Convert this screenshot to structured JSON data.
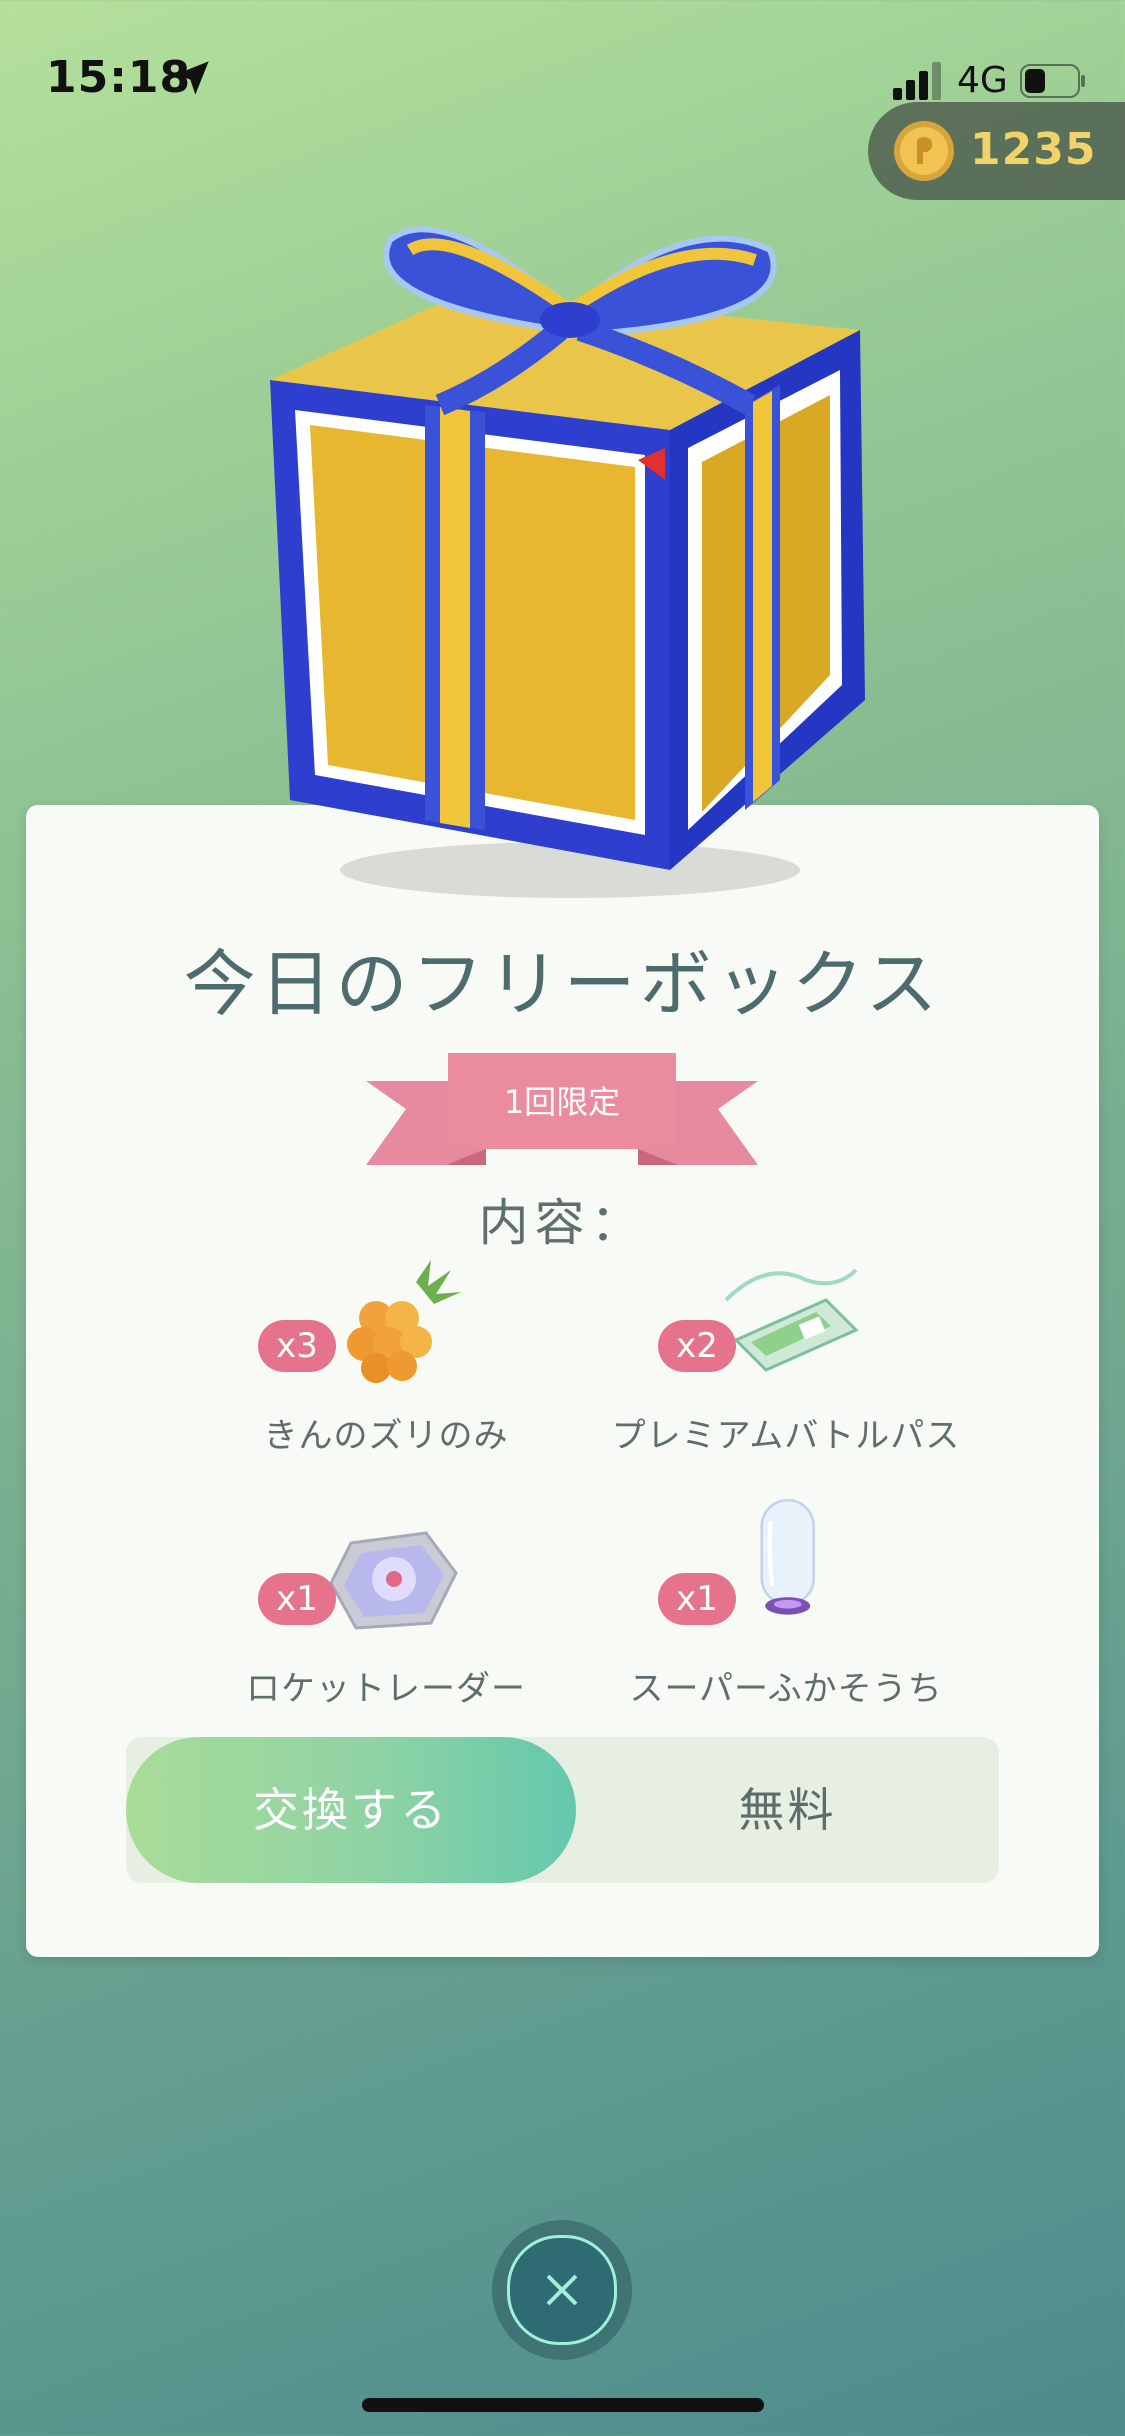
{
  "status_bar": {
    "time": "15:18",
    "network": "4G"
  },
  "coins": {
    "count": "1235"
  },
  "offer": {
    "title": "今日のフリーボックス",
    "limit_label": "1回限定",
    "contents_label": "内容："
  },
  "items": [
    {
      "name": "きんのズリのみ",
      "quantity": "x3",
      "icon": "golden-razz-berry-icon"
    },
    {
      "name": "プレミアムバトルパス",
      "quantity": "x2",
      "icon": "premium-battle-pass-icon"
    },
    {
      "name": "ロケットレーダー",
      "quantity": "x1",
      "icon": "rocket-radar-icon"
    },
    {
      "name": "スーパーふかそうち",
      "quantity": "x1",
      "icon": "super-incubator-icon"
    }
  ],
  "purchase": {
    "button_label": "交換する",
    "price_label": "無料"
  },
  "colors": {
    "badge": "#e5738b",
    "ribbon": "#ea8c9d",
    "coin_text": "#f2d36a",
    "button_gradient_start": "#a9dc98",
    "button_gradient_end": "#64c8ad"
  }
}
